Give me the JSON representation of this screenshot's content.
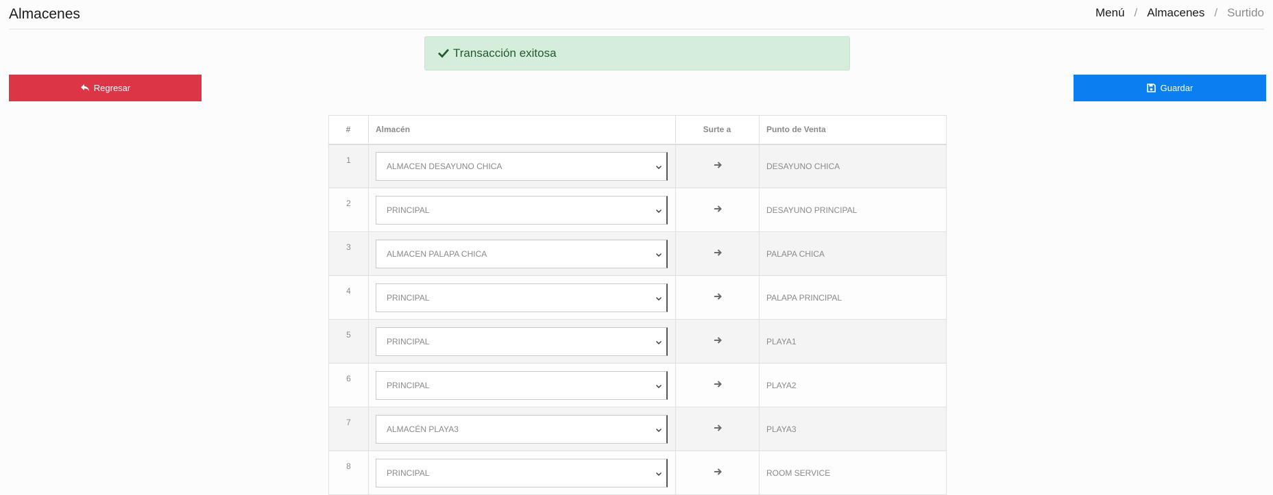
{
  "header": {
    "title": "Almacenes",
    "breadcrumb": [
      "Menú",
      "Almacenes",
      "Surtido"
    ]
  },
  "alert": {
    "icon": "check-icon",
    "text": "Transacción exitosa",
    "color": "#d5eddb"
  },
  "buttons": {
    "back": {
      "label": "Regresar",
      "icon": "reply-icon",
      "color": "#dc3545"
    },
    "save": {
      "label": "Guardar",
      "icon": "floppy-disk-icon",
      "color": "#0a7fef"
    }
  },
  "table": {
    "headers": [
      "#",
      "Almacén",
      "Surte a",
      "Punto de Venta"
    ],
    "rows": [
      {
        "num": "1",
        "almacen": "ALMACEN DESAYUNO CHICA",
        "punto": "DESAYUNO CHICA"
      },
      {
        "num": "2",
        "almacen": "PRINCIPAL",
        "punto": "DESAYUNO PRINCIPAL"
      },
      {
        "num": "3",
        "almacen": "ALMACEN PALAPA CHICA",
        "punto": "PALAPA CHICA"
      },
      {
        "num": "4",
        "almacen": "PRINCIPAL",
        "punto": "PALAPA PRINCIPAL"
      },
      {
        "num": "5",
        "almacen": "PRINCIPAL",
        "punto": "PLAYA1"
      },
      {
        "num": "6",
        "almacen": "PRINCIPAL",
        "punto": "PLAYA2"
      },
      {
        "num": "7",
        "almacen": "ALMACÉN PLAYA3",
        "punto": "PLAYA3"
      },
      {
        "num": "8",
        "almacen": "PRINCIPAL",
        "punto": "ROOM SERVICE"
      }
    ]
  }
}
